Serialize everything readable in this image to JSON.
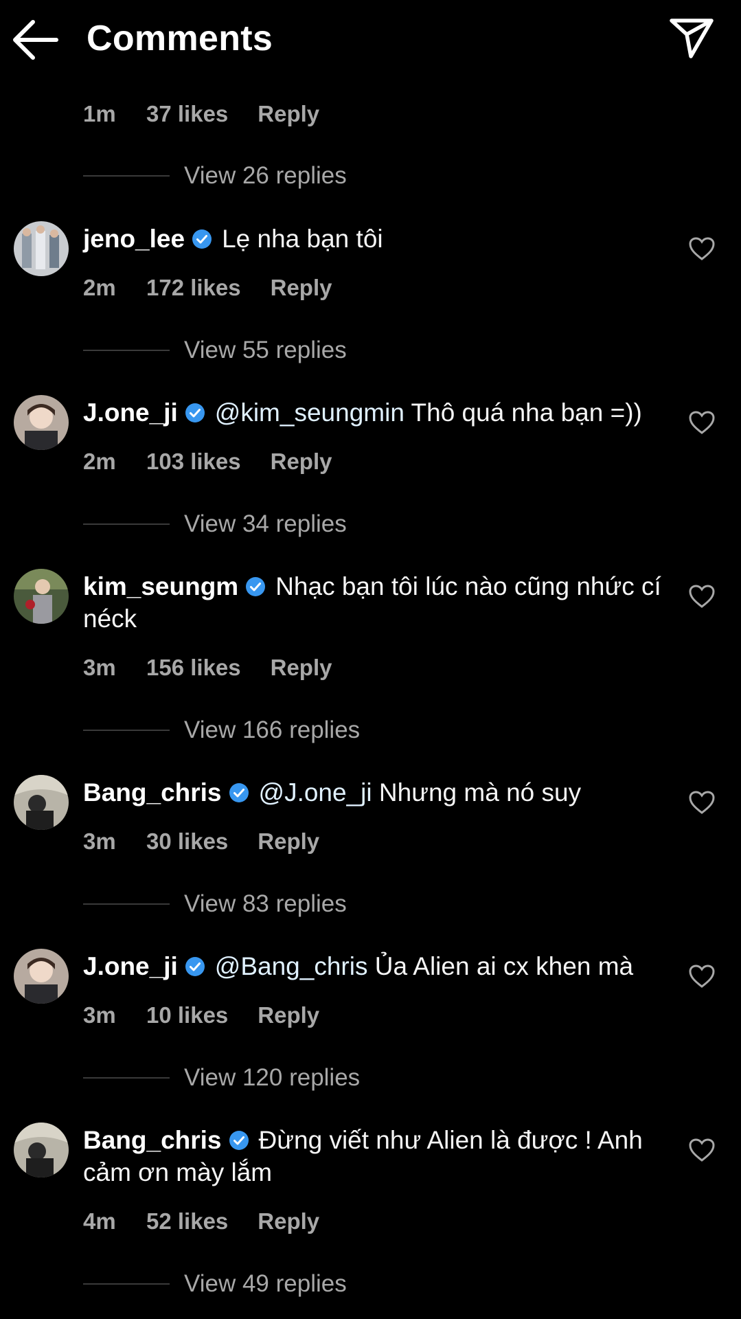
{
  "header": {
    "title": "Comments",
    "back_icon": "arrow-left-icon",
    "send_icon": "paper-plane-icon"
  },
  "colors": {
    "background": "#000000",
    "text": "#f5f5f5",
    "secondary": "#a8a8a8",
    "verified": "#3897f0"
  },
  "top_partial": {
    "time": "1m",
    "likes": "37 likes",
    "reply": "Reply",
    "view_replies": "View 26 replies"
  },
  "comments": [
    {
      "username": "jeno_lee",
      "mention": "",
      "text": "Lẹ nha bạn tôi",
      "time": "2m",
      "likes": "172 likes",
      "reply": "Reply",
      "view_replies": "View 55 replies"
    },
    {
      "username": "J.one_ji",
      "mention": "@kim_seungmin",
      "text": "Thô quá nha bạn =))",
      "time": "2m",
      "likes": "103 likes",
      "reply": "Reply",
      "view_replies": "View 34 replies"
    },
    {
      "username": "kim_seungm",
      "mention": "",
      "text": "Nhạc bạn tôi lúc nào cũng nhức cí néck",
      "time": "3m",
      "likes": "156 likes",
      "reply": "Reply",
      "view_replies": "View 166 replies"
    },
    {
      "username": "Bang_chris",
      "mention": "@J.one_ji",
      "text": "Nhưng mà nó suy",
      "time": "3m",
      "likes": "30 likes",
      "reply": "Reply",
      "view_replies": "View 83 replies"
    },
    {
      "username": "J.one_ji",
      "mention": "@Bang_chris",
      "text": "Ủa Alien ai cx khen mà",
      "time": "3m",
      "likes": "10 likes",
      "reply": "Reply",
      "view_replies": "View 120 replies"
    },
    {
      "username": "Bang_chris",
      "mention": "",
      "text": "Đừng viết như Alien là được ! Anh cảm ơn mày lắm",
      "time": "4m",
      "likes": "52 likes",
      "reply": "Reply",
      "view_replies": "View 49 replies"
    }
  ]
}
